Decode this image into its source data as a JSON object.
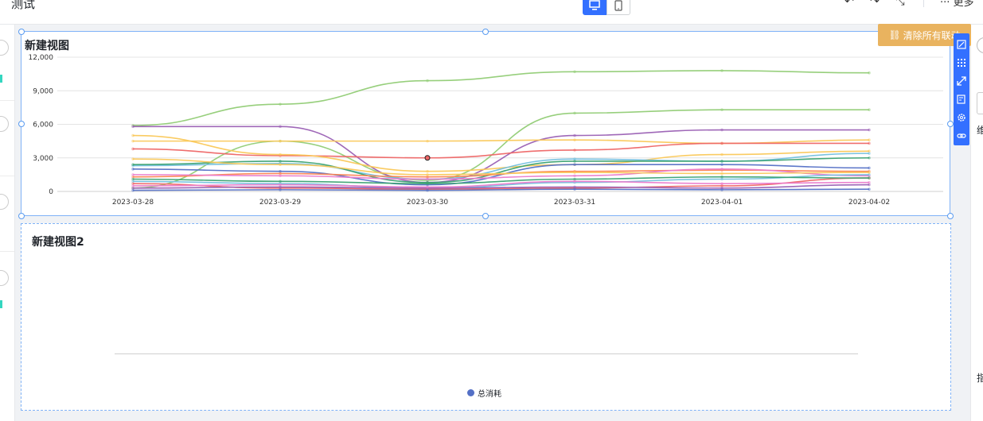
{
  "header": {
    "title": "测试",
    "more_label": "更多",
    "undo_icon": "undo-icon",
    "redo_icon": "redo-icon",
    "collapse_icon": "collapse-icon"
  },
  "device_toggle": {
    "desktop_icon": "desktop-icon",
    "mobile_icon": "mobile-icon"
  },
  "right_panel": {
    "text_1": "维",
    "text_2": "指"
  },
  "clear_linkage_button": "清除所有联动",
  "colors": {
    "accent": "#3370ff",
    "clear_button": "#e9b35f",
    "selection": "#7fb2f7"
  },
  "view1": {
    "title": "新建视图",
    "chart_data": {
      "type": "line",
      "x": [
        "2023-03-28",
        "2023-03-29",
        "2023-03-30",
        "2023-03-31",
        "2023-04-01",
        "2023-04-02"
      ],
      "y_ticks": [
        "0",
        "3,000",
        "6,000",
        "9,000",
        "12,000"
      ],
      "ylim": [
        0,
        12000
      ],
      "grid": true,
      "series": [
        {
          "color": "#91cc75",
          "values": [
            5900,
            7800,
            9900,
            10700,
            10800,
            10600
          ]
        },
        {
          "color": "#91cc75",
          "values": [
            300,
            4500,
            1000,
            7000,
            7300,
            7300
          ]
        },
        {
          "color": "#9a60b4",
          "values": [
            5800,
            5800,
            800,
            5000,
            5500,
            5500
          ]
        },
        {
          "color": "#fac858",
          "values": [
            4500,
            4500,
            4500,
            4600,
            4300,
            4600
          ]
        },
        {
          "color": "#ee6666",
          "values": [
            3800,
            3200,
            3000,
            3700,
            4300,
            4300
          ]
        },
        {
          "color": "#fac858",
          "values": [
            5000,
            3300,
            1800,
            2400,
            3300,
            3600
          ]
        },
        {
          "color": "#73c0de",
          "values": [
            2300,
            2500,
            1100,
            2900,
            2700,
            3400
          ]
        },
        {
          "color": "#3ba272",
          "values": [
            2400,
            2700,
            800,
            2700,
            2700,
            3000
          ]
        },
        {
          "color": "#5470c6",
          "values": [
            2000,
            1800,
            600,
            2400,
            2400,
            2100
          ]
        },
        {
          "color": "#fc8452",
          "values": [
            1300,
            1600,
            1300,
            1800,
            1900,
            1800
          ]
        },
        {
          "color": "#ea7ccc",
          "values": [
            1500,
            1400,
            1100,
            1400,
            2000,
            1400
          ]
        },
        {
          "color": "#73c0de",
          "values": [
            900,
            700,
            300,
            800,
            1100,
            1500
          ]
        },
        {
          "color": "#ee6666",
          "values": [
            700,
            300,
            200,
            300,
            500,
            1200
          ]
        },
        {
          "color": "#9a60b4",
          "values": [
            300,
            400,
            300,
            400,
            300,
            600
          ]
        },
        {
          "color": "#3ba272",
          "values": [
            1100,
            900,
            700,
            1100,
            1300,
            1200
          ]
        },
        {
          "color": "#fac858",
          "values": [
            2900,
            2400,
            1500,
            1700,
            1600,
            1700
          ]
        },
        {
          "color": "#5470c6",
          "values": [
            100,
            150,
            100,
            200,
            150,
            200
          ]
        },
        {
          "color": "#ea7ccc",
          "values": [
            500,
            600,
            400,
            900,
            700,
            800
          ]
        }
      ],
      "highlight_point": {
        "x": "2023-03-30",
        "y": 3000
      }
    }
  },
  "view2": {
    "title": "新建视图2",
    "chart_data": {
      "type": "line",
      "series": [
        {
          "name": "总消耗",
          "color": "#5470c6",
          "values": []
        }
      ]
    }
  }
}
